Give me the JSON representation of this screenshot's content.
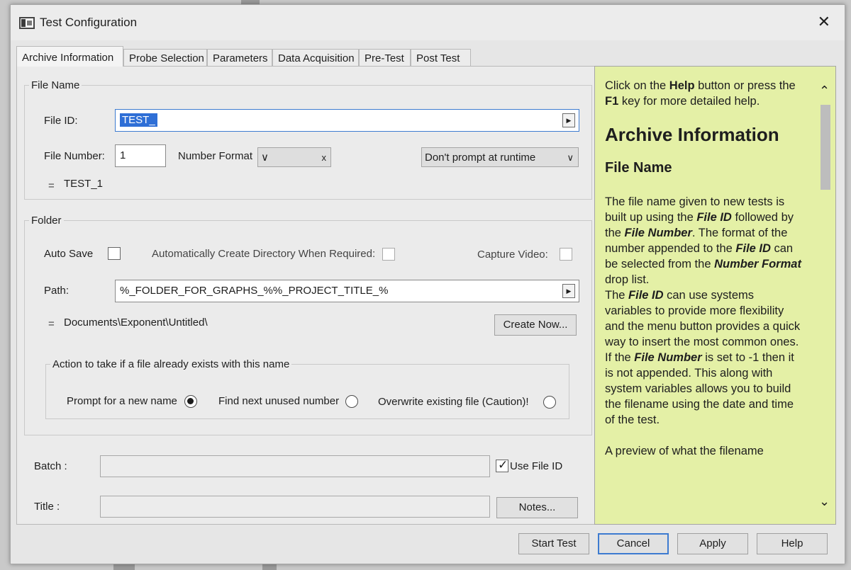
{
  "window": {
    "title": "Test Configuration",
    "close_glyph": "✕"
  },
  "tabs": [
    {
      "label": "Archive Information"
    },
    {
      "label": "Probe Selection"
    },
    {
      "label": "Parameters"
    },
    {
      "label": "Data Acquisition"
    },
    {
      "label": "Pre-Test"
    },
    {
      "label": "Post Test"
    }
  ],
  "file_name": {
    "legend": "File Name",
    "file_id_label": "File ID:",
    "file_id_value": "TEST_",
    "file_number_label": "File Number:",
    "file_number_value": "1",
    "number_format_label": "Number Format",
    "number_format_value": "",
    "number_format_clear": "x",
    "prompt_option": "Don't prompt at runtime",
    "preview_eq": "=",
    "preview": "TEST_1"
  },
  "folder": {
    "legend": "Folder",
    "auto_save_label": "Auto Save",
    "auto_save_checked": false,
    "auto_create_label": "Automatically Create Directory  When Required:",
    "auto_create_checked": false,
    "capture_video_label": "Capture Video:",
    "capture_video_checked": false,
    "path_label": "Path:",
    "path_value": "%_FOLDER_FOR_GRAPHS_%%_PROJECT_TITLE_%",
    "resolved_eq": "=",
    "resolved_path": "Documents\\Exponent\\Untitled\\",
    "create_now_label": "Create Now..."
  },
  "action": {
    "legend": "Action to take if a file already exists with this name",
    "options": [
      {
        "label": "Prompt for a new name",
        "selected": true
      },
      {
        "label": "Find next unused number",
        "selected": false
      },
      {
        "label": "Overwrite existing file (Caution)!",
        "selected": false
      }
    ]
  },
  "batch": {
    "label": "Batch :",
    "value": "",
    "use_file_id_label": "Use File ID",
    "use_file_id_checked": true
  },
  "title_field": {
    "label": "Title :",
    "value": "",
    "notes_label": "Notes..."
  },
  "help": {
    "intro_1": "Click on the ",
    "intro_help": "Help",
    "intro_2": " button or press the ",
    "intro_f1": "F1",
    "intro_3": " key for more detailed help.",
    "heading": "Archive Information",
    "subheading": "File Name",
    "p1_a": "The file name given to new tests is built up using the ",
    "p1_fileid": "File ID",
    "p1_b": " followed by the ",
    "p1_filenumber": "File Number",
    "p1_c": ". The format of the number appended to the ",
    "p1_fileid2": "File ID",
    "p1_d": " can be selected from the ",
    "p1_numberformat": "Number Format",
    "p1_e": " drop list.",
    "p2_a": "The ",
    "p2_fileid": "File ID",
    "p2_b": " can use systems variables to provide more flexibility and the menu button provides a quick way to insert the most common ones.",
    "p3_a": "If the ",
    "p3_filenumber": "File Number",
    "p3_b": " is set to -1 then it is not appended. This along with system variables allows you to build the filename using the date and time of the test.",
    "p4": "A preview of what the filename"
  },
  "buttons": {
    "start_test": "Start Test",
    "cancel": "Cancel",
    "apply": "Apply",
    "help": "Help"
  }
}
